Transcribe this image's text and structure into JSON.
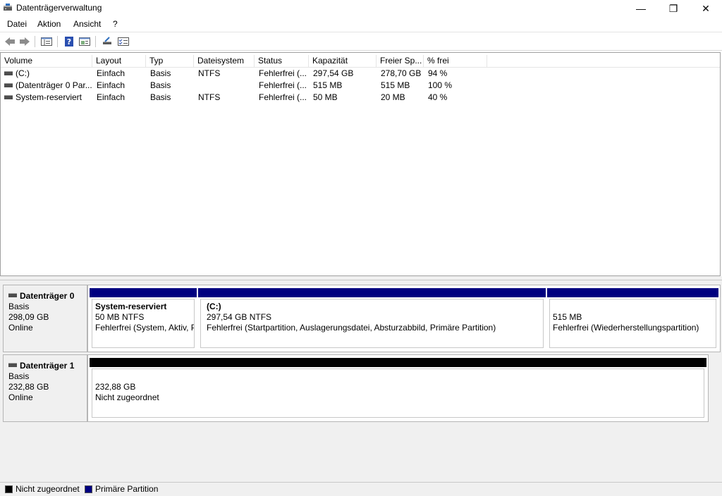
{
  "window": {
    "title": "Datenträgerverwaltung",
    "minimize": "—",
    "maximize": "❐",
    "close": "✕"
  },
  "menu": [
    "Datei",
    "Aktion",
    "Ansicht",
    "?"
  ],
  "toolbar_icons": [
    "back-arrow-icon",
    "forward-arrow-icon",
    "console-tree-icon",
    "help-icon",
    "properties-icon",
    "connect-icon",
    "checklist-icon"
  ],
  "volume_list": {
    "columns": [
      "Volume",
      "Layout",
      "Typ",
      "Dateisystem",
      "Status",
      "Kapazität",
      "Freier Sp...",
      "% frei"
    ],
    "rows": [
      [
        "(C:)",
        "Einfach",
        "Basis",
        "NTFS",
        "Fehlerfrei (...",
        "297,54 GB",
        "278,70 GB",
        "94 %"
      ],
      [
        "(Datenträger 0 Par...",
        "Einfach",
        "Basis",
        "",
        "Fehlerfrei (...",
        "515 MB",
        "515 MB",
        "100 %"
      ],
      [
        "System-reserviert",
        "Einfach",
        "Basis",
        "NTFS",
        "Fehlerfrei (...",
        "50 MB",
        "20 MB",
        "40 %"
      ]
    ]
  },
  "disks": [
    {
      "name": "Datenträger 0",
      "type": "Basis",
      "size": "298,09 GB",
      "status": "Online",
      "partitions": [
        {
          "name": "System-reserviert",
          "size": "50 MB NTFS",
          "status": "Fehlerfrei (System, Aktiv, P",
          "kind": "primary"
        },
        {
          "name": "(C:)",
          "size": "297,54 GB NTFS",
          "status": "Fehlerfrei (Startpartition, Auslagerungsdatei, Absturzabbild, Primäre Partition)",
          "kind": "primary"
        },
        {
          "name": "",
          "size": "515 MB",
          "status": "Fehlerfrei (Wiederherstellungspartition)",
          "kind": "primary"
        }
      ]
    },
    {
      "name": "Datenträger 1",
      "type": "Basis",
      "size": "232,88 GB",
      "status": "Online",
      "partitions": [
        {
          "name": "",
          "size": "232,88 GB",
          "status": "Nicht zugeordnet",
          "kind": "unalloc"
        }
      ]
    }
  ],
  "legend": [
    {
      "label": "Nicht zugeordnet",
      "color": "#000000"
    },
    {
      "label": "Primäre Partition",
      "color": "#000080"
    }
  ]
}
